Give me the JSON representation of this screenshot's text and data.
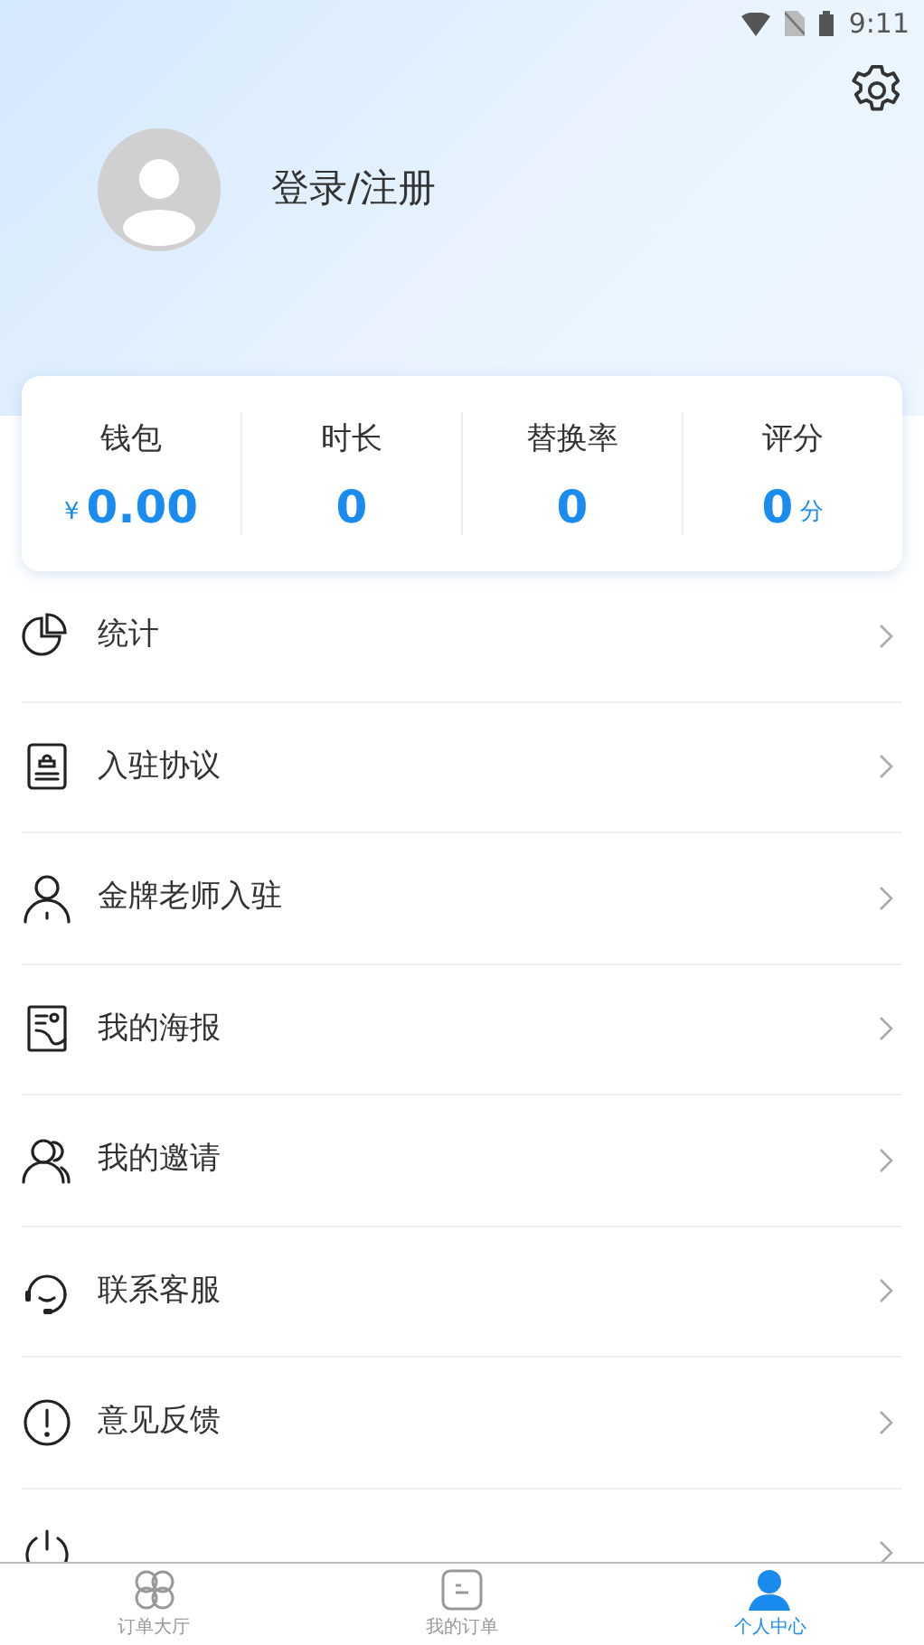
{
  "status_bar": {
    "time": "9:11"
  },
  "profile": {
    "login_label": "登录/注册"
  },
  "stats": [
    {
      "label": "钱包",
      "prefix": "¥",
      "value": "0.00"
    },
    {
      "label": "时长",
      "value": "0"
    },
    {
      "label": "替换率",
      "value": "0"
    },
    {
      "label": "评分",
      "value": "0",
      "suffix": "分"
    }
  ],
  "menu": [
    {
      "kind": "pie",
      "label": "统计"
    },
    {
      "kind": "document",
      "label": "入驻协议"
    },
    {
      "kind": "person",
      "label": "金牌老师入驻"
    },
    {
      "kind": "poster",
      "label": "我的海报"
    },
    {
      "kind": "people",
      "label": "我的邀请"
    },
    {
      "kind": "headset",
      "label": "联系客服"
    },
    {
      "kind": "alert",
      "label": "意见反馈"
    },
    {
      "kind": "power"
    }
  ],
  "tabs": [
    {
      "kind": "grid",
      "label": "订单大厅",
      "selected": false
    },
    {
      "kind": "orders",
      "label": "我的订单",
      "selected": false
    },
    {
      "kind": "user",
      "label": "个人中心",
      "selected": true
    }
  ]
}
